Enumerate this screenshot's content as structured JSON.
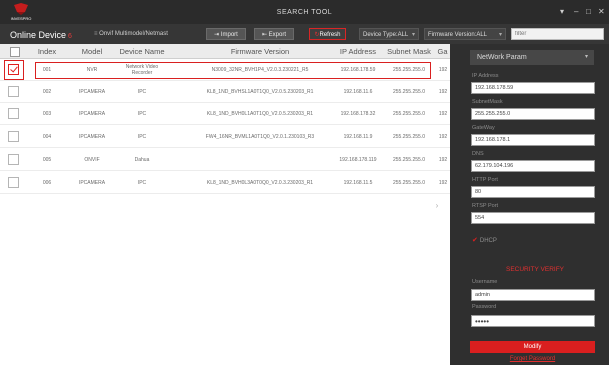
{
  "window": {
    "title": "SEARCH TOOL",
    "logo_text": "INVESPRO",
    "controls": [
      "▾",
      "–",
      "□",
      "✕"
    ]
  },
  "toolbar": {
    "online_label": "Online Device",
    "online_count": "6",
    "multicast_label": "Onvif Multimodel/Netmast",
    "import_label": "Import",
    "export_label": "Export",
    "refresh_label": "Refresh",
    "device_type_label": "Device Type:ALL",
    "firmware_version_label": "Firmware Version:ALL",
    "filter_placeholder": "filter"
  },
  "table": {
    "headers": [
      "Index",
      "Model",
      "Device Name",
      "Firmware Version",
      "IP Address",
      "Subnet Mask",
      "Ga"
    ],
    "rows": [
      {
        "checked": true,
        "index": "001",
        "model": "NVR",
        "name": "Network Video Recorder",
        "firmware": "N3009_32NR_BVH1P4_V2.0.3.230221_R5",
        "ip": "192.168.178.59",
        "mask": "255.255.255.0",
        "gw": "192"
      },
      {
        "checked": false,
        "index": "002",
        "model": "IPCAMERA",
        "name": "IPC",
        "firmware": "KL8_1ND_BVHSL1A0T1Q0_V2.0.5.230203_R1",
        "ip": "192.168.11.6",
        "mask": "255.255.255.0",
        "gw": "192"
      },
      {
        "checked": false,
        "index": "003",
        "model": "IPCAMERA",
        "name": "IPC",
        "firmware": "KL8_1ND_BVH0L1A0T1Q0_V2.0.5.230203_R1",
        "ip": "192.168.178.32",
        "mask": "255.255.255.0",
        "gw": "192"
      },
      {
        "checked": false,
        "index": "004",
        "model": "IPCAMERA",
        "name": "IPC",
        "firmware": "FW4_16NR_BVML1A0T1Q0_V2.0.1.230103_R3",
        "ip": "192.168.11.9",
        "mask": "255.255.255.0",
        "gw": "192"
      },
      {
        "checked": false,
        "index": "005",
        "model": "ONVIF",
        "name": "Dahua",
        "firmware": "",
        "ip": "192.168.178.119",
        "mask": "255.255.255.0",
        "gw": "192"
      },
      {
        "checked": false,
        "index": "006",
        "model": "IPCAMERA",
        "name": "IPC",
        "firmware": "KL8_1ND_BVH0L3A0T0Q0_V2.0.3.230203_R1",
        "ip": "192.168.11.5",
        "mask": "255.255.255.0",
        "gw": "192"
      }
    ]
  },
  "panel": {
    "section_select": "NetWork Param",
    "ip_label": "IP Address",
    "ip_value": "192.168.178.59",
    "mask_label": "SubnetMask",
    "mask_value": "255.255.255.0",
    "gateway_label": "GateWay",
    "gateway_value": "192.168.178.1",
    "dns_label": "DNS",
    "dns_value": "62.179.104.196",
    "http_label": "HTTP Port",
    "http_value": "80",
    "rtsp_label": "RTSP Port",
    "rtsp_value": "554",
    "dhcp_label": "DHCP",
    "security_title": "SECURITY VERIFY",
    "username_label": "Username",
    "username_value": "admin",
    "password_label": "Password",
    "password_value": "•••••",
    "modify_label": "Modify",
    "forgot_label": "Forget Password"
  },
  "colors": {
    "accent": "#d92020",
    "titlebar": "#2b2b2b",
    "panel": "#2f2f2f"
  }
}
